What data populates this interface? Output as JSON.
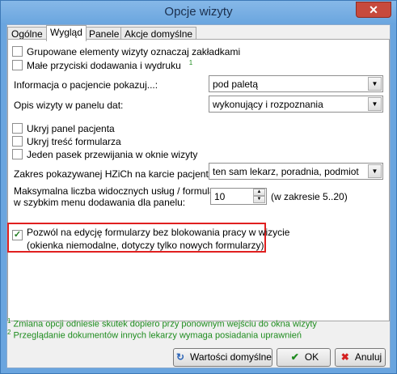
{
  "window": {
    "title": "Opcje wizyty"
  },
  "tabs": [
    {
      "label": "Ogólne",
      "active": false
    },
    {
      "label": "Wygląd",
      "active": true
    },
    {
      "label": "Panele",
      "active": false
    },
    {
      "label": "Akcje domyślne",
      "active": false
    }
  ],
  "options": {
    "group_tabs": {
      "label": "Grupowane elementy wizyty oznaczaj zakładkami",
      "checked": false
    },
    "small_buttons": {
      "label": "Małe przyciski dodawania i wydruku",
      "note": "1",
      "checked": false
    },
    "patient_info": {
      "label": "Informacja o pacjencie pokazuj...:",
      "value": "pod paletą"
    },
    "visit_desc": {
      "label": "Opis wizyty w panelu dat:",
      "value": "wykonujący i rozpoznania"
    },
    "hide_patient_panel": {
      "label": "Ukryj panel pacjenta",
      "checked": false
    },
    "hide_form_content": {
      "label": "Ukryj treść formularza",
      "checked": false
    },
    "one_scroll": {
      "label": "Jeden pasek przewijania w oknie wizyty",
      "checked": false
    },
    "hzich_range": {
      "label": "Zakres pokazywanej HZiCh na karcie pacjenta:",
      "note": "2",
      "value": "ten sam lekarz, poradnia, podmiot"
    },
    "max_services": {
      "label_line1": "Maksymalna liczba widocznych usług / formularzy",
      "label_line2": "w szybkim menu dodawania dla panelu:",
      "value": "10",
      "range": "(w zakresie 5..20)"
    },
    "non_blocking": {
      "label_line1": "Pozwól na edycję formularzy bez blokowania pracy w wizycie",
      "label_line2": "(okienka niemodalne, dotyczy tylko nowych formularzy)",
      "checked": true
    }
  },
  "notes": {
    "n1": "Zmiana opcji odniesie skutek dopiero przy ponownym wejściu do okna wizyty",
    "n2": "Przeglądanie dokumentów innych lekarzy wymaga posiadania uprawnień",
    "n1_num": "1",
    "n2_num": "2"
  },
  "buttons": {
    "defaults": "Wartości domyślne",
    "ok": "OK",
    "cancel": "Anuluj"
  }
}
